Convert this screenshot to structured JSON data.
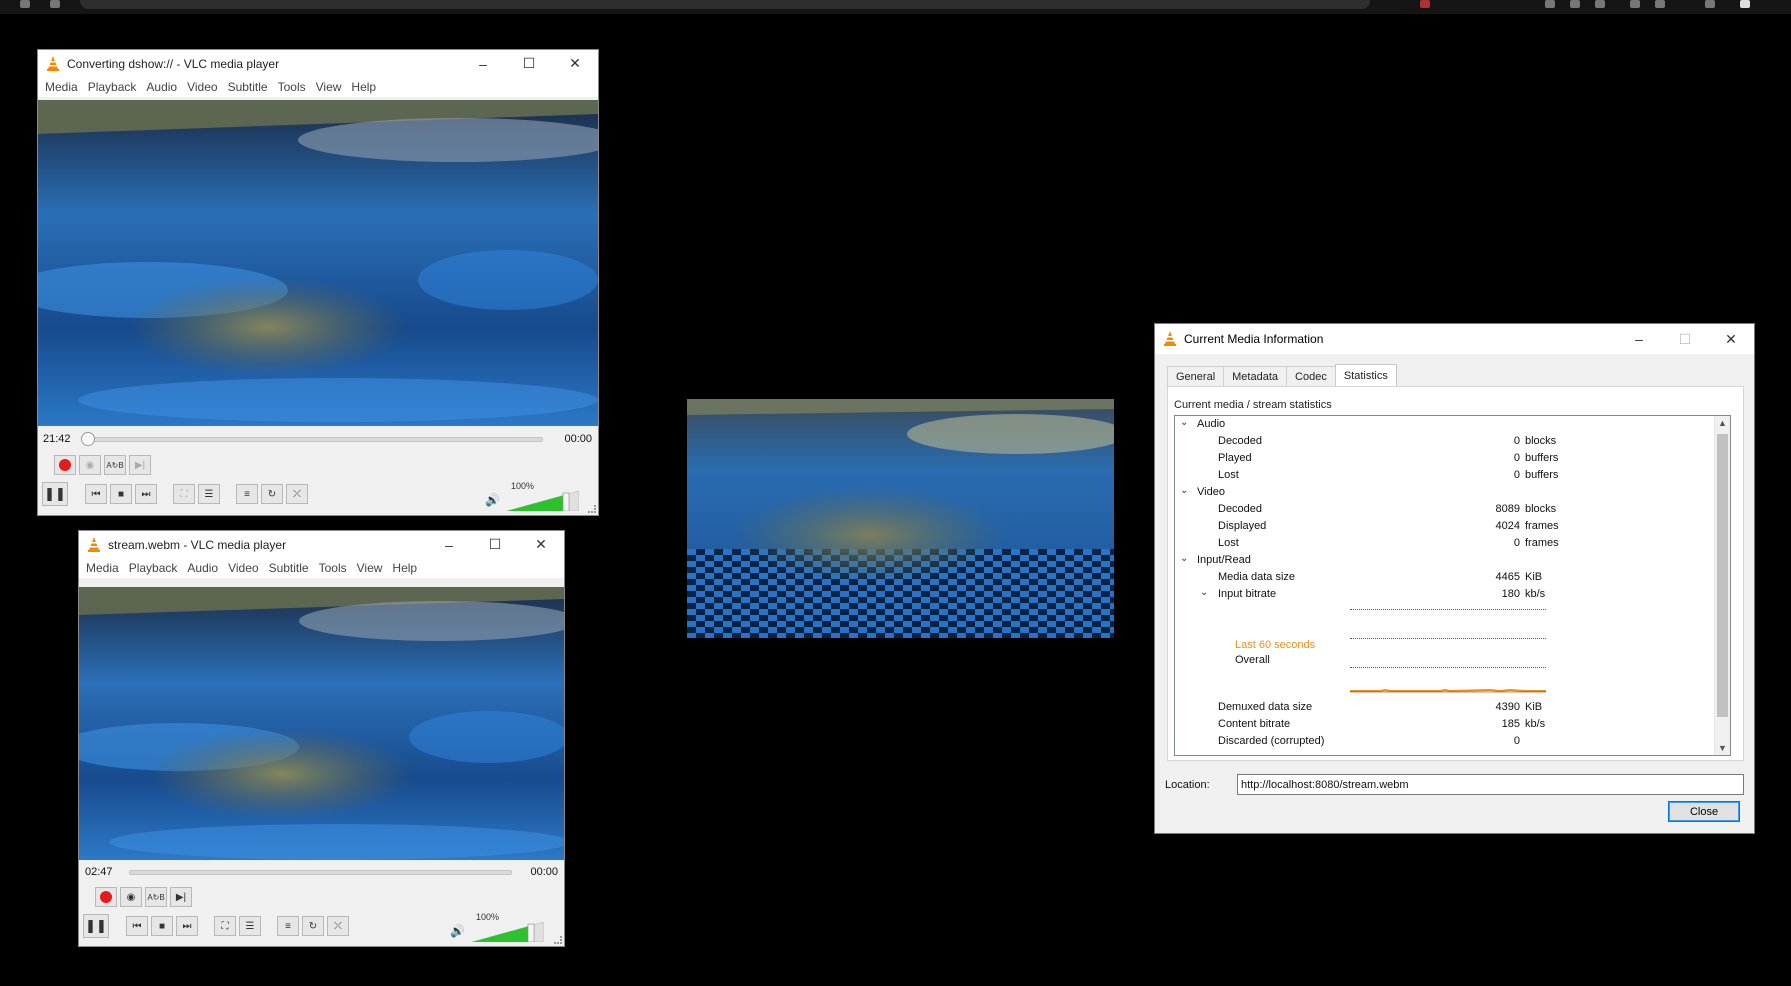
{
  "vlc_top": {
    "title": "Converting dshow:// - VLC media player",
    "menu": [
      "Media",
      "Playback",
      "Audio",
      "Video",
      "Subtitle",
      "Tools",
      "View",
      "Help"
    ],
    "time_elapsed": "21:42",
    "time_total": "00:00",
    "volume": "100%"
  },
  "vlc_bottom": {
    "title": "stream.webm - VLC media player",
    "menu": [
      "Media",
      "Playback",
      "Audio",
      "Video",
      "Subtitle",
      "Tools",
      "View",
      "Help"
    ],
    "time_elapsed": "02:47",
    "time_total": "00:00",
    "volume": "100%"
  },
  "info": {
    "title": "Current Media Information",
    "tabs": [
      "General",
      "Metadata",
      "Codec",
      "Statistics"
    ],
    "active_tab": "Statistics",
    "panel_label": "Current media / stream statistics",
    "rows": [
      {
        "label": "Audio",
        "group": true
      },
      {
        "label": "Decoded",
        "value": "0",
        "unit": "blocks"
      },
      {
        "label": "Played",
        "value": "0",
        "unit": "buffers"
      },
      {
        "label": "Lost",
        "value": "0",
        "unit": "buffers"
      },
      {
        "label": "Video",
        "group": true
      },
      {
        "label": "Decoded",
        "value": "8089",
        "unit": "blocks"
      },
      {
        "label": "Displayed",
        "value": "4024",
        "unit": "frames"
      },
      {
        "label": "Lost",
        "value": "0",
        "unit": "frames"
      },
      {
        "label": "Input/Read",
        "group": true
      },
      {
        "label": "Media data size",
        "value": "4465",
        "unit": "KiB"
      },
      {
        "label": "Input bitrate",
        "value": "180",
        "unit": "kb/s"
      },
      {
        "label": "Demuxed data size",
        "value": "4390",
        "unit": "KiB"
      },
      {
        "label": "Content bitrate",
        "value": "185",
        "unit": "kb/s"
      },
      {
        "label": "Discarded (corrupted)",
        "value": "0",
        "unit": ""
      }
    ],
    "legend_last60": "Last 60 seconds",
    "legend_overall": "Overall",
    "location_label": "Location:",
    "location_value": "http://localhost:8080/stream.webm",
    "close_label": "Close"
  },
  "colors": {
    "legend_last60": "#e8901c",
    "record": "#e41b1b",
    "volume_green": "#2ec12e"
  }
}
